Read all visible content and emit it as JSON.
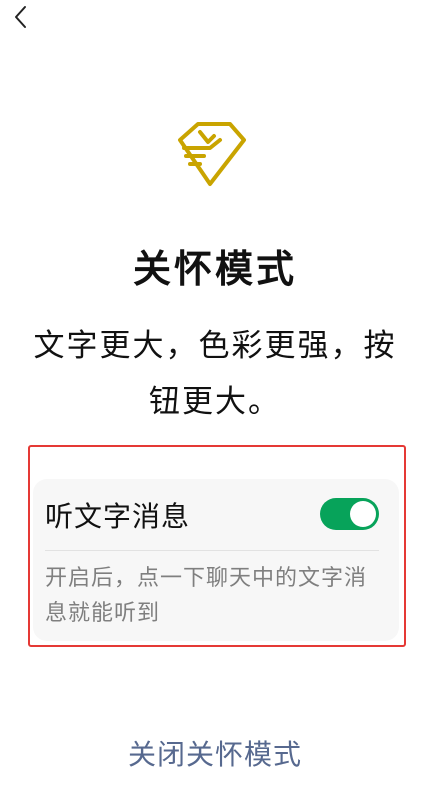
{
  "nav": {
    "back_icon": "chevron-left-icon"
  },
  "logo": {
    "icon": "care-hand-heart-icon",
    "color": "#c9a400"
  },
  "title": "关怀模式",
  "description": "文字更大，色彩更强，按钮更大。",
  "setting": {
    "label": "听文字消息",
    "enabled": true,
    "toggle_color": "#07a35a",
    "description": "开启后，点一下聊天中的文字消息就能听到"
  },
  "highlight_color": "#e53935",
  "close_link": "关闭关怀模式",
  "close_link_color": "#57698f"
}
